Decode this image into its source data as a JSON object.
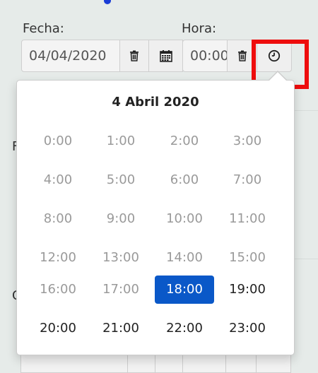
{
  "form": {
    "date_label": "Fecha:",
    "time_label": "Hora:",
    "date_value": "04/04/2020",
    "time_value": "00:00"
  },
  "icons": {
    "date_clear": "trash-icon",
    "date_calendar": "calendar-icon",
    "time_clear": "trash-icon",
    "time_clock": "clock-icon"
  },
  "colors": {
    "highlight_border": "#ee0d0d",
    "selected_hour_bg": "#0a58c8"
  },
  "picker": {
    "title": "4 Abril 2020",
    "selected": "18:00",
    "hours": [
      {
        "label": "0:00",
        "state": "disabled"
      },
      {
        "label": "1:00",
        "state": "disabled"
      },
      {
        "label": "2:00",
        "state": "disabled"
      },
      {
        "label": "3:00",
        "state": "disabled"
      },
      {
        "label": "4:00",
        "state": "disabled"
      },
      {
        "label": "5:00",
        "state": "disabled"
      },
      {
        "label": "6:00",
        "state": "disabled"
      },
      {
        "label": "7:00",
        "state": "disabled"
      },
      {
        "label": "8:00",
        "state": "disabled"
      },
      {
        "label": "9:00",
        "state": "disabled"
      },
      {
        "label": "10:00",
        "state": "disabled"
      },
      {
        "label": "11:00",
        "state": "disabled"
      },
      {
        "label": "12:00",
        "state": "disabled"
      },
      {
        "label": "13:00",
        "state": "disabled"
      },
      {
        "label": "14:00",
        "state": "disabled"
      },
      {
        "label": "15:00",
        "state": "disabled"
      },
      {
        "label": "16:00",
        "state": "disabled"
      },
      {
        "label": "17:00",
        "state": "disabled"
      },
      {
        "label": "18:00",
        "state": "active"
      },
      {
        "label": "19:00",
        "state": "enabled"
      },
      {
        "label": "20:00",
        "state": "enabled"
      },
      {
        "label": "21:00",
        "state": "enabled"
      },
      {
        "label": "22:00",
        "state": "enabled"
      },
      {
        "label": "23:00",
        "state": "enabled"
      }
    ]
  }
}
